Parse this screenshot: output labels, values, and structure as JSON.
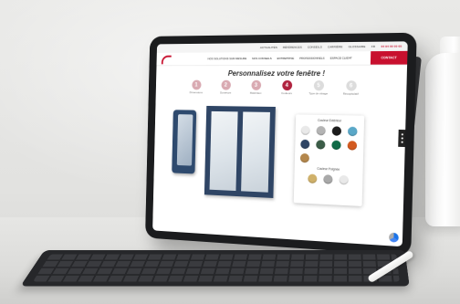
{
  "site": {
    "topbar_links": [
      "ACTUALITÉS",
      "RÉFÉRENCES",
      "CONSEILS",
      "CARRIÈRE",
      "GLOSSAIRE",
      "FR"
    ],
    "topbar_phone": "04 94 00 00 00",
    "nav": [
      "NOS SOLUTIONS SUR-MESURE",
      "NOS CONSEILS",
      "ENTREPRISE",
      "PROFESSIONNELS",
      "ESPACE CLIENT"
    ],
    "contact_label": "CONTACT",
    "logo_text": "RENOVAL"
  },
  "configurator": {
    "title": "Personnalisez votre fenêtre !",
    "steps": [
      {
        "num": "1",
        "label": "Dimensions",
        "state": "done"
      },
      {
        "num": "2",
        "label": "Ouverture",
        "state": "done"
      },
      {
        "num": "3",
        "label": "Matériaux",
        "state": "done"
      },
      {
        "num": "4",
        "label": "Couleurs",
        "state": "active"
      },
      {
        "num": "5",
        "label": "Type de vitrage",
        "state": "todo"
      },
      {
        "num": "6",
        "label": "Récapitulatif",
        "state": "todo"
      }
    ],
    "color_panel": {
      "exterior_title": "Couleur Extérieur",
      "exterior_colors": [
        "#e9e9e9",
        "#b4b4b4",
        "#1c1c1c",
        "#5aa8c8",
        "#2f4565",
        "#3c5d48",
        "#0f6b47",
        "#d35a1f",
        "#b4874c"
      ],
      "special_title": "Couleur Poignée",
      "special_colors": [
        "#d0b16a",
        "#a9a9a9",
        "#e9e9e9"
      ]
    }
  }
}
